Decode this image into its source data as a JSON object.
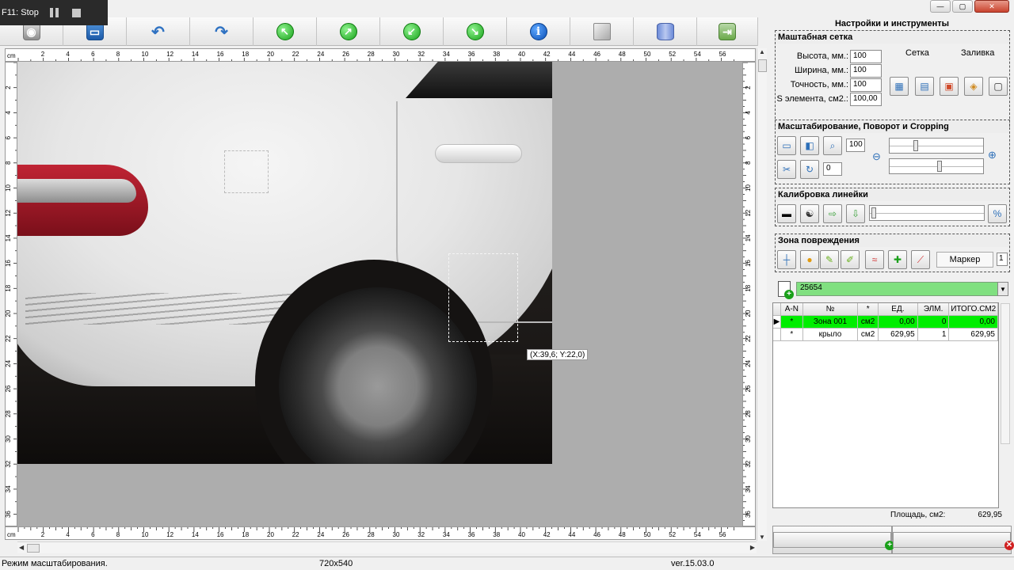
{
  "recorder": {
    "label": "F11: Stop"
  },
  "toolbar": {
    "buttons": [
      {
        "name": "camera-icon"
      },
      {
        "name": "save-icon"
      },
      {
        "name": "undo-icon"
      },
      {
        "name": "redo-icon"
      },
      {
        "name": "arrow-up-left-icon"
      },
      {
        "name": "arrow-up-right-icon"
      },
      {
        "name": "arrow-down-left-icon"
      },
      {
        "name": "arrow-down-right-icon"
      },
      {
        "name": "info-icon"
      },
      {
        "name": "cube-icon"
      },
      {
        "name": "database-icon"
      },
      {
        "name": "exit-icon"
      }
    ]
  },
  "ruler": {
    "unit": "cm",
    "h_ticks": [
      "2",
      "4",
      "6",
      "8",
      "10",
      "12",
      "14",
      "16",
      "18",
      "20",
      "22",
      "24",
      "26",
      "28",
      "30",
      "32",
      "34",
      "36",
      "38",
      "40",
      "42",
      "44",
      "46",
      "48",
      "50",
      "52",
      "54",
      "56"
    ],
    "v_ticks": [
      "2",
      "4",
      "6",
      "8",
      "10",
      "12",
      "14",
      "16",
      "18",
      "20",
      "22",
      "24",
      "26",
      "28",
      "30",
      "32",
      "34",
      "36"
    ]
  },
  "canvas": {
    "coord_readout": "(X:39,6; Y:22,0)"
  },
  "panel": {
    "title": "Настройки и инструменты",
    "scale_grid": {
      "header": "Маштабная сетка",
      "height_label": "Высота, мм.:",
      "height_value": "100",
      "width_label": "Ширина, мм.:",
      "width_value": "100",
      "precision_label": "Точность, мм.:",
      "precision_value": "100",
      "area_label": "S элемента, см2.:",
      "area_value": "100,00",
      "grid_label": "Сетка",
      "fill_label": "Заливка"
    },
    "zoom": {
      "header": "Масштабирование, Поворот и Cropping",
      "zoom_value": "100",
      "rotate_value": "0"
    },
    "calibration": {
      "header": "Калибровка линейки"
    },
    "damage": {
      "header": "Зона повреждения",
      "marker_label": "Маркер",
      "marker_value": "1"
    },
    "combo_value": "25654",
    "table": {
      "headers": [
        "A-N",
        "№",
        "*",
        "ЕД.",
        "ЭЛМ.",
        "ИТОГО.СМ2"
      ],
      "rows": [
        {
          "an": "*",
          "name": "Зона 001",
          "unit": "см2",
          "ed": "0,00",
          "elm": "0",
          "total": "0,00"
        },
        {
          "an": "*",
          "name": "крыло",
          "unit": "см2",
          "ed": "629,95",
          "elm": "1",
          "total": "629,95"
        }
      ]
    },
    "area_total_label": "Площадь, см2:",
    "area_total_value": "629,95"
  },
  "status": {
    "mode": "Режим масштабирования.",
    "size": "720x540",
    "version": "ver.15.03.0"
  },
  "colors": {
    "selected_row": "#00ee00",
    "combo_bg": "#80e080"
  }
}
